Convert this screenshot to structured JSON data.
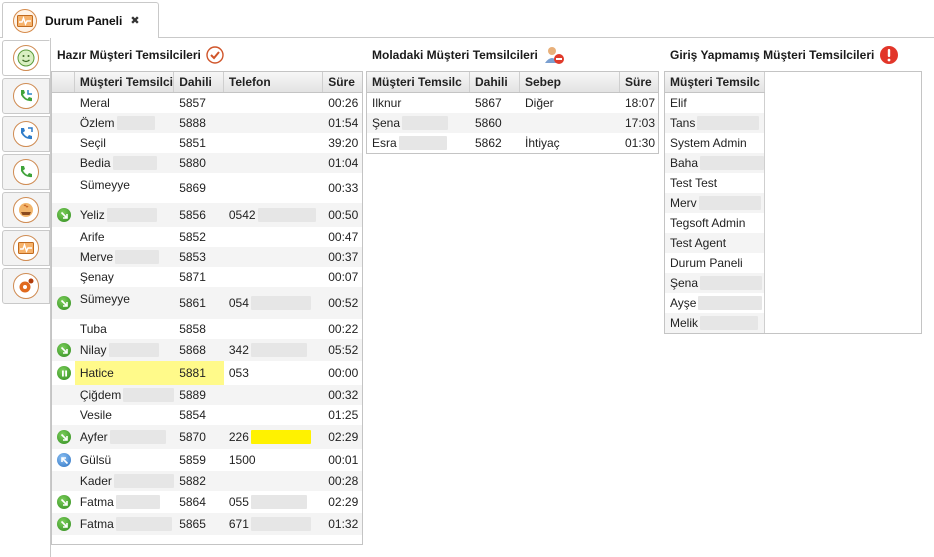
{
  "tab": {
    "title": "Durum Paneli",
    "close": "✖"
  },
  "left_tabs": [
    {
      "icon": "face-icon"
    },
    {
      "icon": "phone-incoming-icon"
    },
    {
      "icon": "phone-outgoing-icon"
    },
    {
      "icon": "phone-icon"
    },
    {
      "icon": "coffee-break-icon"
    },
    {
      "icon": "dashboard-icon"
    },
    {
      "icon": "settings-icon"
    }
  ],
  "ready": {
    "title": "Hazır Müşteri Temsilcileri",
    "headers": [
      "Müşteri Temsilci",
      "Dahili",
      "Telefon",
      "Süre"
    ],
    "rows": [
      {
        "name": "Meral",
        "ext": "5857",
        "phone": "",
        "time": "00:26",
        "icon": "none"
      },
      {
        "name": "Özlem",
        "ext": "5888",
        "phone": "",
        "time": "01:54",
        "icon": "none"
      },
      {
        "name": "Seçil",
        "ext": "5851",
        "phone": "",
        "time": "39:20",
        "icon": "none"
      },
      {
        "name": "Bedia",
        "ext": "5880",
        "phone": "",
        "time": "01:04",
        "icon": "none"
      },
      {
        "name": "Sümeyye",
        "ext": "5869",
        "phone": "",
        "time": "00:33",
        "icon": "none"
      },
      {
        "name": "Yeliz",
        "ext": "5856",
        "phone": "0542",
        "time": "00:50",
        "icon": "green-arrow"
      },
      {
        "name": "Arife",
        "ext": "5852",
        "phone": "",
        "time": "00:47",
        "icon": "none"
      },
      {
        "name": "Merve",
        "ext": "5853",
        "phone": "",
        "time": "00:37",
        "icon": "none"
      },
      {
        "name": "Şenay",
        "ext": "5871",
        "phone": "",
        "time": "00:07",
        "icon": "none"
      },
      {
        "name": "Sümeyye",
        "ext": "5861",
        "phone": "054",
        "time": "00:52",
        "icon": "green-arrow"
      },
      {
        "name": "Tuba",
        "ext": "5858",
        "phone": "",
        "time": "00:22",
        "icon": "none"
      },
      {
        "name": "Nilay",
        "ext": "5868",
        "phone": "342",
        "time": "05:52",
        "icon": "green-arrow"
      },
      {
        "name": "Hatice",
        "ext": "5881",
        "phone": "053",
        "time": "00:00",
        "icon": "green-pause"
      },
      {
        "name": "Çiğdem",
        "ext": "5889",
        "phone": "",
        "time": "00:32",
        "icon": "none"
      },
      {
        "name": "Vesile",
        "ext": "5854",
        "phone": "",
        "time": "01:25",
        "icon": "none"
      },
      {
        "name": "Ayfer",
        "ext": "5870",
        "phone": "226",
        "time": "02:29",
        "icon": "green-arrow"
      },
      {
        "name": "Gülsü",
        "ext": "5859",
        "phone": "1500",
        "time": "00:01",
        "icon": "blue-arrow"
      },
      {
        "name": "Kader",
        "ext": "5882",
        "phone": "",
        "time": "00:28",
        "icon": "none"
      },
      {
        "name": "Fatma",
        "ext": "5864",
        "phone": "055",
        "time": "02:29",
        "icon": "green-arrow"
      },
      {
        "name": "Fatma",
        "ext": "5865",
        "phone": "671",
        "time": "01:32",
        "icon": "green-arrow"
      }
    ]
  },
  "break": {
    "title": "Moladaki Müşteri Temsilcileri",
    "headers": [
      "Müşteri Temsilc",
      "Dahili",
      "Sebep",
      "Süre"
    ],
    "rows": [
      {
        "name": "Ilknur",
        "ext": "5867",
        "reason": "Diğer",
        "time": "18:07"
      },
      {
        "name": "Şena",
        "ext": "5860",
        "reason": "",
        "time": "17:03"
      },
      {
        "name": "Esra",
        "ext": "5862",
        "reason": "İhtiyaç",
        "time": "01:30"
      }
    ]
  },
  "offline": {
    "title": "Giriş Yapmamış Müşteri Temsilcileri",
    "headers": [
      "Müşteri Temsilc"
    ],
    "rows": [
      "Elif",
      "Tans",
      "System Admin",
      "Baha",
      "Test Test",
      "Merv",
      "Tegsoft Admin",
      "Test Agent",
      "Durum Paneli",
      "Şena",
      "Ayşe",
      "Melik"
    ]
  }
}
